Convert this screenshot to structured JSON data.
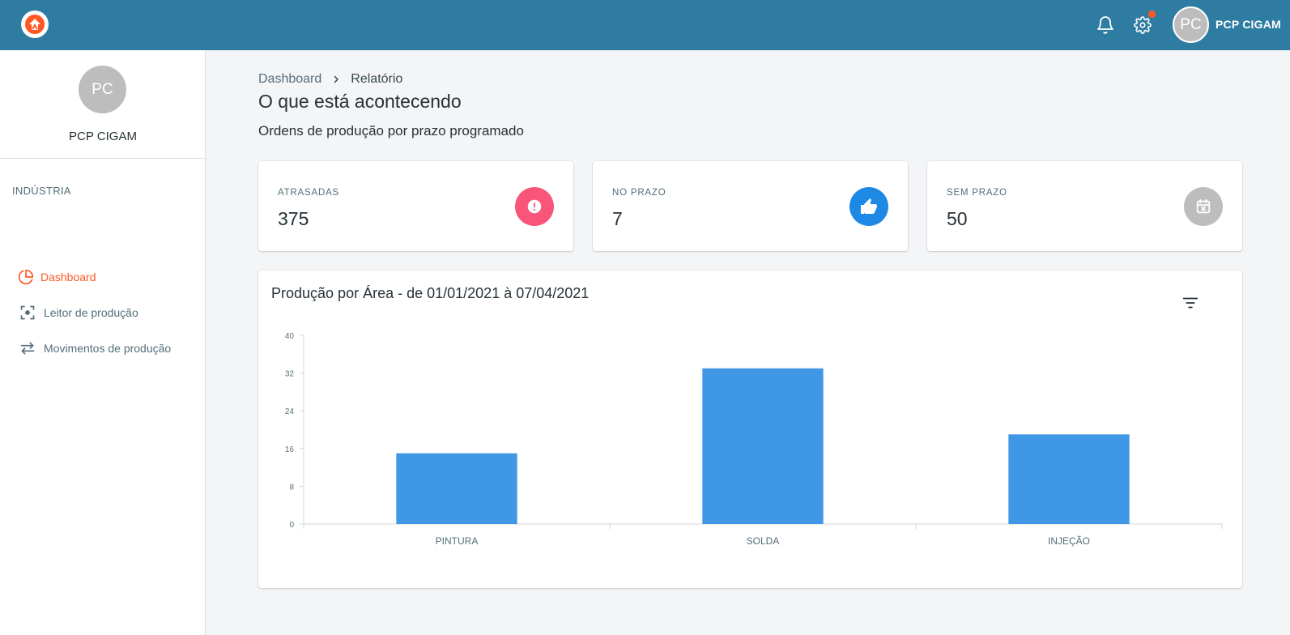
{
  "topbar": {
    "user_initials": "PC",
    "user_name": "PCP CIGAM",
    "icons": [
      "logo-icon",
      "bell-icon",
      "gear-icon"
    ],
    "colors": {
      "bar": "#2f7ca3",
      "notification_dot": "#ff5722"
    }
  },
  "sidebar": {
    "initials": "PC",
    "name": "PCP CIGAM",
    "section": "INDÚSTRIA",
    "items": [
      {
        "label": "Dashboard",
        "icon": "pie-chart-icon",
        "active": true
      },
      {
        "label": "Leitor de produção",
        "icon": "scan-icon",
        "active": false
      },
      {
        "label": "Movimentos de produção",
        "icon": "swap-arrows-icon",
        "active": false
      }
    ]
  },
  "main": {
    "breadcrumb": [
      "Dashboard",
      "Relatório"
    ],
    "title": "O que está acontecendo",
    "subtitle": "Ordens de produção por prazo programado",
    "cards": [
      {
        "label": "ATRASADAS",
        "value": "375",
        "icon": "exclamation-icon",
        "color": "#f9557a"
      },
      {
        "label": "NO PRAZO",
        "value": "7",
        "icon": "thumbs-up-icon",
        "color": "#1e88e5"
      },
      {
        "label": "SEM PRAZO",
        "value": "50",
        "icon": "calendar-x-icon",
        "color": "#bdbdbd"
      }
    ]
  },
  "chart_data": {
    "type": "bar",
    "title": "Produção por Área - de 01/01/2021 à 07/04/2021",
    "categories": [
      "PINTURA",
      "SOLDA",
      "INJEÇÃO"
    ],
    "values": [
      15,
      33,
      19
    ],
    "xlabel": "",
    "ylabel": "",
    "ylim": [
      0,
      40
    ],
    "yticks": [
      0,
      8,
      16,
      24,
      32,
      40
    ],
    "grid": false,
    "bar_color": "#3f97e6"
  }
}
